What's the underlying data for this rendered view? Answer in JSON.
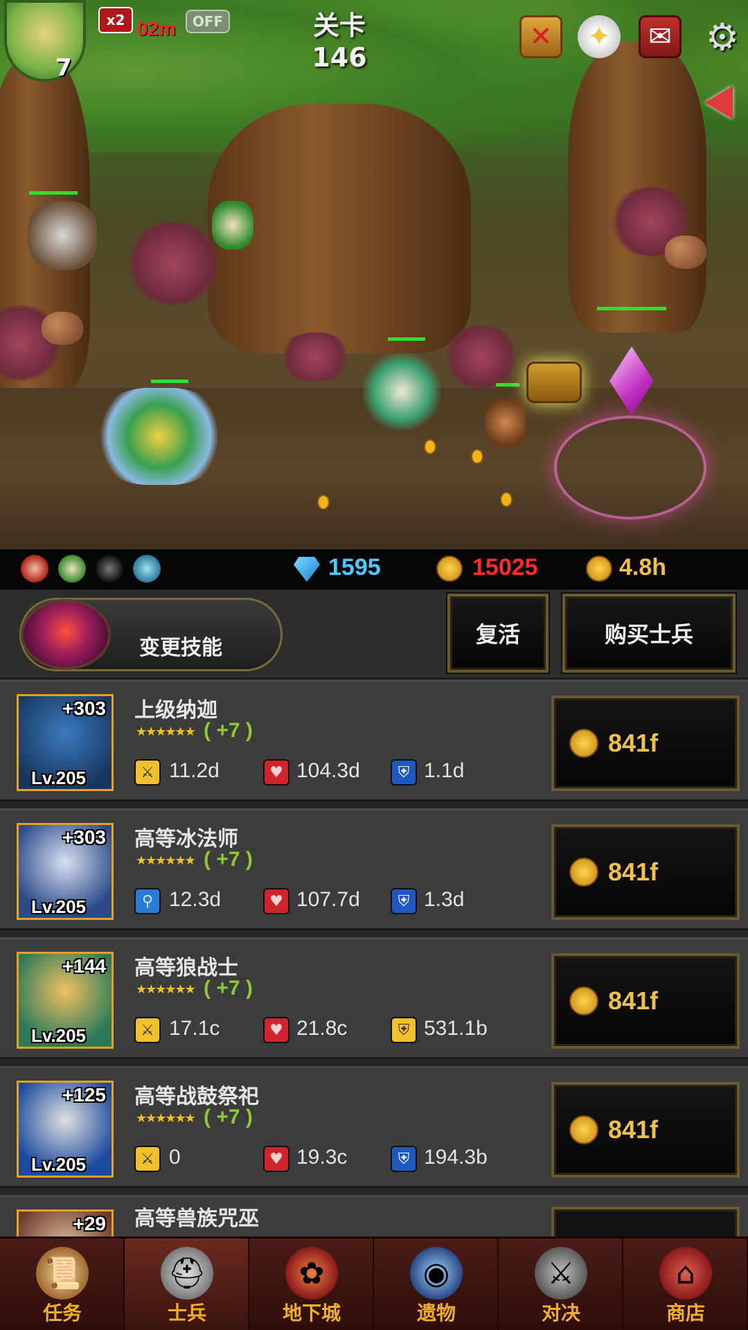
{
  "hud": {
    "player_level": "7",
    "speed_multiplier": "x2",
    "speed_timer": "02m",
    "auto_toggle": "OFF",
    "stage_title": "关卡 146",
    "icons": [
      "flag-icon",
      "angel-icon",
      "mailbox-icon",
      "gear-icon",
      "back-arrow-icon"
    ]
  },
  "resources": {
    "gems": "1595",
    "medals": "15025",
    "offline_time": "4.8h"
  },
  "actions": {
    "change_skill_label": "变更技能",
    "revive_label": "复活",
    "buy_soldier_label": "购买士兵"
  },
  "soldiers": [
    {
      "name": "上级纳迦",
      "plus": "+303",
      "level": "Lv.205",
      "stars": "★★★★★★",
      "bonus": "( +7 )",
      "atk_icon": "sword-icon",
      "atk": "11.2d",
      "hp": "104.3d",
      "def_icon": "shield-icon",
      "def": "1.1d",
      "price": "841f"
    },
    {
      "name": "高等冰法师",
      "plus": "+303",
      "level": "Lv.205",
      "stars": "★★★★★★",
      "bonus": "( +7 )",
      "atk_icon": "magic-staff-icon",
      "atk": "12.3d",
      "hp": "107.7d",
      "def_icon": "shield-icon",
      "def": "1.3d",
      "price": "841f"
    },
    {
      "name": "高等狼战士",
      "plus": "+144",
      "level": "Lv.205",
      "stars": "★★★★★★",
      "bonus": "( +7 )",
      "atk_icon": "sword-icon",
      "atk": "17.1c",
      "hp": "21.8c",
      "def_icon": "gold-shield-icon",
      "def": "531.1b",
      "price": "841f"
    },
    {
      "name": "高等战鼓祭祀",
      "plus": "+125",
      "level": "Lv.205",
      "stars": "★★★★★★",
      "bonus": "( +7 )",
      "atk_icon": "sword-icon",
      "atk": "0",
      "hp": "19.3c",
      "def_icon": "shield-icon",
      "def": "194.3b",
      "price": "841f"
    },
    {
      "name": "高等兽族咒巫",
      "plus": "+29"
    }
  ],
  "nav": [
    {
      "label": "任务",
      "icon": "scroll-icon"
    },
    {
      "label": "士兵",
      "icon": "helmet-icon"
    },
    {
      "label": "地下城",
      "icon": "monster-plant-icon"
    },
    {
      "label": "遗物",
      "icon": "orb-icon"
    },
    {
      "label": "对决",
      "icon": "crossed-swords-icon"
    },
    {
      "label": "商店",
      "icon": "shop-icon"
    }
  ],
  "colors": {
    "gem_blue": "#4fc8ff",
    "medal_red": "#ff2a2a",
    "gold": "#f1c04a",
    "nav_label": "#f0b020",
    "bonus_green": "#8ecb2e"
  }
}
